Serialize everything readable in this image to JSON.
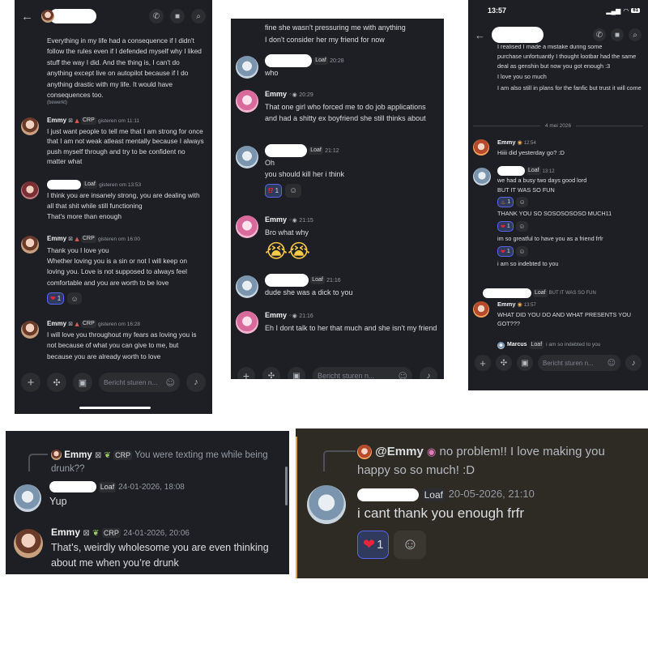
{
  "p1": {
    "messages": [
      {
        "text": "Everything in my life had a consequence if I didn't follow the rules even if I defended myself why I liked stuff the way I did. And the thing is, I can't do anything except live on autopilot because if I do anything drastic with my life. It would have consequences too.",
        "edited": "(bewerkt)"
      },
      {
        "name": "Emmy",
        "tag": "CRP",
        "time": "gisteren om 11:11",
        "text": "I just want people to tell me that I am strong for once that I am not weak atleast mentally because I always push myself through and try to be confident no matter what"
      },
      {
        "tag": "Loaf",
        "time": "gisteren om 13:53",
        "text": "I think you are insanely strong, you are dealing with all that shit while still functioning",
        "text2": "That's more than enough"
      },
      {
        "name": "Emmy",
        "tag": "CRP",
        "time": "gisteren om 16:00",
        "text": "Thank you I love you",
        "text2": "Whether loving you is a sin or not I will keep on loving you. Love is not supposed to always feel comfortable and you are worth to be love",
        "react_count": "1"
      },
      {
        "name": "Emmy",
        "tag": "CRP",
        "time": "gisteren om 16:28",
        "text": "I will love you throughout my fears as loving you is not because of what you can give to me, but because you are already worth to love"
      }
    ],
    "input_placeholder": "Bericht sturen n..."
  },
  "p2": {
    "top1": "fine she wasn't pressuring me with anything",
    "top2": "I don't consider her my friend for now",
    "messages": [
      {
        "tag": "Loaf",
        "time": "20:28",
        "text": "who"
      },
      {
        "name": "Emmy",
        "time": "20:29",
        "text": "That one girl who forced me to do job applications and had a shitty ex boyfriend she still thinks about"
      },
      {
        "tag": "Loaf",
        "time": "21:12",
        "text1": "Oh",
        "text": "you should kill her i think",
        "react_count": "1"
      },
      {
        "name": "Emmy",
        "time": "21:15",
        "text": "Bro what why"
      },
      {
        "tag": "Loaf",
        "time": "21:16",
        "text": "dude she was a dick to you"
      },
      {
        "name": "Emmy",
        "time": "21:16",
        "text": "Eh I dont talk to her that much and she isn't my friend"
      }
    ],
    "input_placeholder": "Bericht sturen n..."
  },
  "p3": {
    "status_time": "13:57",
    "battery": "61",
    "top1": "I realised I made a mistake during some",
    "top2": "purchase unfortuantly I thought lootbar had the same deal as genshin but now you got enough :3",
    "top3": "I love you so much",
    "top4": "I am also still in plans for the fanfic but trust it will come",
    "date_divider": "4 mei 2026",
    "m1": {
      "name": "Emmy",
      "time": "12:54",
      "text": "Hiiii did yesterday go? :D"
    },
    "m2": {
      "tag": "Loaf",
      "time": "13:12",
      "lines": [
        "we had a busy two days good lord",
        "BUT IT WAS SO FUN",
        "THANK YOU SO SOSOSOSOSO MUCH11",
        "im so greatful to have you as a friend frfr",
        "i am so indebted to you"
      ],
      "react_count": "1"
    },
    "reply_preview": "BUT IT WAS SO FUN",
    "m3": {
      "name": "Emmy",
      "time": "13:57",
      "text": "WHAT DID YOU DO AND WHAT PRESENTS YOU GOT???"
    },
    "reply2": {
      "name": "Marcus",
      "tag": "Loaf",
      "text": "i am so indebted to you"
    },
    "input_placeholder": "Bericht sturen n..."
  },
  "p4": {
    "reply_name": "Emmy",
    "reply_tag": "CRP",
    "reply_text": "You were texting me while being drunk??",
    "m1": {
      "tag": "Loaf",
      "time": "24-01-2026, 18:08",
      "text": "Yup"
    },
    "m2": {
      "name": "Emmy",
      "tag": "CRP",
      "time": "24-01-2026, 20:06",
      "text": "That’s, weirdly wholesome you are even thinking about me when you’re drunk"
    }
  },
  "p5": {
    "reply_name": "@Emmy",
    "reply_text": "no problem!! I love making you happy so so much! :D",
    "m1": {
      "tag": "Loaf",
      "time": "20-05-2026, 21:10",
      "text": "i cant thank you enough frfr",
      "react_count": "1"
    }
  }
}
